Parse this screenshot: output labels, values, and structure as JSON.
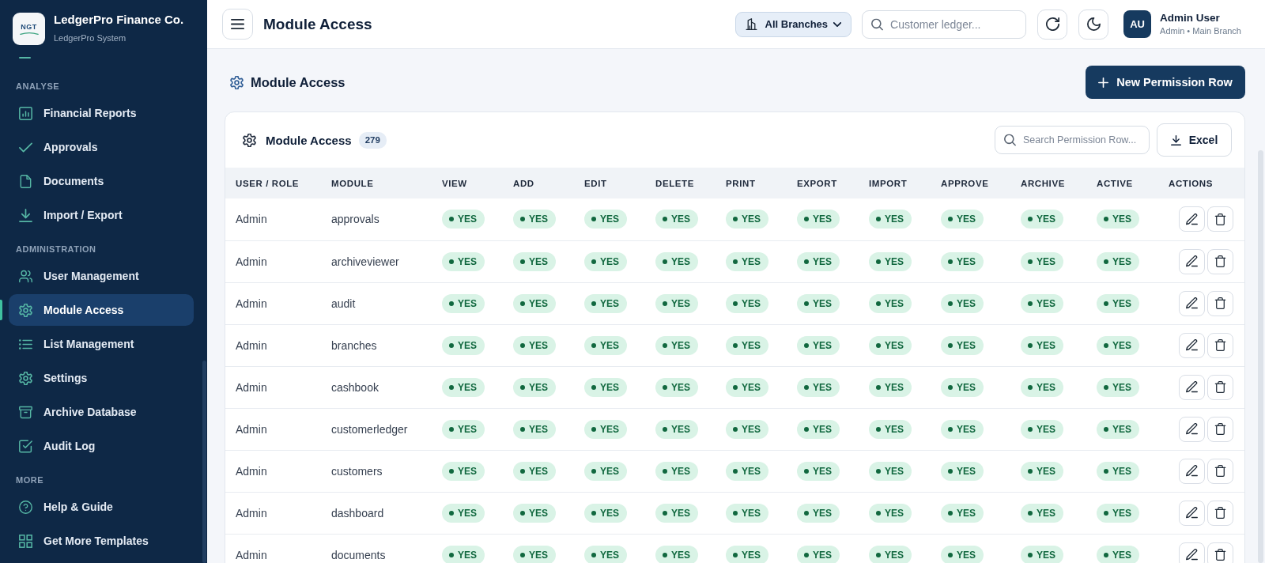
{
  "sidebar": {
    "brand": {
      "logo_text": "NGT",
      "name": "LedgerPro Finance Co.",
      "subtitle": "LedgerPro System"
    },
    "sections": [
      {
        "label": "ANALYSE",
        "items": [
          {
            "label": "Financial Reports",
            "selected": false
          },
          {
            "label": "Approvals",
            "selected": false
          },
          {
            "label": "Documents",
            "selected": false
          },
          {
            "label": "Import / Export",
            "selected": false
          }
        ]
      },
      {
        "label": "ADMINISTRATION",
        "items": [
          {
            "label": "User Management",
            "selected": false
          },
          {
            "label": "Module Access",
            "selected": true
          },
          {
            "label": "List Management",
            "selected": false
          },
          {
            "label": "Settings",
            "selected": false
          },
          {
            "label": "Archive Database",
            "selected": false
          },
          {
            "label": "Audit Log",
            "selected": false
          }
        ]
      },
      {
        "label": "MORE",
        "items": [
          {
            "label": "Help & Guide",
            "selected": false
          },
          {
            "label": "Get More Templates",
            "selected": false
          }
        ]
      }
    ]
  },
  "header": {
    "title": "Module Access",
    "branch_filter": "All Branches",
    "search": {
      "placeholder": "Customer ledger..."
    },
    "user": {
      "initials": "AU",
      "name": "Admin User",
      "role": "Admin • Main Branch"
    }
  },
  "page": {
    "title": "Module Access",
    "new_button": "New Permission Row"
  },
  "table_card": {
    "title": "Module Access",
    "count": "279",
    "search": {
      "placeholder": "Search Permission Row..."
    },
    "export_button": "Excel",
    "columns": [
      "USER / ROLE",
      "MODULE",
      "VIEW",
      "ADD",
      "EDIT",
      "DELETE",
      "PRINT",
      "EXPORT",
      "IMPORT",
      "APPROVE",
      "ARCHIVE",
      "ACTIVE",
      "ACTIONS"
    ],
    "rows": [
      {
        "user": "Admin",
        "module": "approvals",
        "permissions": [
          {
            "label": "YES",
            "granted": true
          },
          {
            "label": "YES",
            "granted": true
          },
          {
            "label": "YES",
            "granted": true
          },
          {
            "label": "YES",
            "granted": true
          },
          {
            "label": "YES",
            "granted": true
          },
          {
            "label": "YES",
            "granted": true
          },
          {
            "label": "YES",
            "granted": true
          },
          {
            "label": "YES",
            "granted": true
          },
          {
            "label": "YES",
            "granted": true
          },
          {
            "label": "YES",
            "granted": true
          }
        ]
      },
      {
        "user": "Admin",
        "module": "archiveviewer",
        "permissions": [
          {
            "label": "YES",
            "granted": true
          },
          {
            "label": "YES",
            "granted": true
          },
          {
            "label": "YES",
            "granted": true
          },
          {
            "label": "YES",
            "granted": true
          },
          {
            "label": "YES",
            "granted": true
          },
          {
            "label": "YES",
            "granted": true
          },
          {
            "label": "YES",
            "granted": true
          },
          {
            "label": "YES",
            "granted": true
          },
          {
            "label": "YES",
            "granted": true
          },
          {
            "label": "YES",
            "granted": true
          }
        ]
      },
      {
        "user": "Admin",
        "module": "audit",
        "permissions": [
          {
            "label": "YES",
            "granted": true
          },
          {
            "label": "YES",
            "granted": true
          },
          {
            "label": "YES",
            "granted": true
          },
          {
            "label": "YES",
            "granted": true
          },
          {
            "label": "YES",
            "granted": true
          },
          {
            "label": "YES",
            "granted": true
          },
          {
            "label": "YES",
            "granted": true
          },
          {
            "label": "YES",
            "granted": true
          },
          {
            "label": "YES",
            "granted": true
          },
          {
            "label": "YES",
            "granted": true
          }
        ]
      },
      {
        "user": "Admin",
        "module": "branches",
        "permissions": [
          {
            "label": "YES",
            "granted": true
          },
          {
            "label": "YES",
            "granted": true
          },
          {
            "label": "YES",
            "granted": true
          },
          {
            "label": "YES",
            "granted": true
          },
          {
            "label": "YES",
            "granted": true
          },
          {
            "label": "YES",
            "granted": true
          },
          {
            "label": "YES",
            "granted": true
          },
          {
            "label": "YES",
            "granted": true
          },
          {
            "label": "YES",
            "granted": true
          },
          {
            "label": "YES",
            "granted": true
          }
        ]
      },
      {
        "user": "Admin",
        "module": "cashbook",
        "permissions": [
          {
            "label": "YES",
            "granted": true
          },
          {
            "label": "YES",
            "granted": true
          },
          {
            "label": "YES",
            "granted": true
          },
          {
            "label": "YES",
            "granted": true
          },
          {
            "label": "YES",
            "granted": true
          },
          {
            "label": "YES",
            "granted": true
          },
          {
            "label": "YES",
            "granted": true
          },
          {
            "label": "YES",
            "granted": true
          },
          {
            "label": "YES",
            "granted": true
          },
          {
            "label": "YES",
            "granted": true
          }
        ]
      },
      {
        "user": "Admin",
        "module": "customerledger",
        "permissions": [
          {
            "label": "YES",
            "granted": true
          },
          {
            "label": "YES",
            "granted": true
          },
          {
            "label": "YES",
            "granted": true
          },
          {
            "label": "YES",
            "granted": true
          },
          {
            "label": "YES",
            "granted": true
          },
          {
            "label": "YES",
            "granted": true
          },
          {
            "label": "YES",
            "granted": true
          },
          {
            "label": "YES",
            "granted": true
          },
          {
            "label": "YES",
            "granted": true
          },
          {
            "label": "YES",
            "granted": true
          }
        ]
      },
      {
        "user": "Admin",
        "module": "customers",
        "permissions": [
          {
            "label": "YES",
            "granted": true
          },
          {
            "label": "YES",
            "granted": true
          },
          {
            "label": "YES",
            "granted": true
          },
          {
            "label": "YES",
            "granted": true
          },
          {
            "label": "YES",
            "granted": true
          },
          {
            "label": "YES",
            "granted": true
          },
          {
            "label": "YES",
            "granted": true
          },
          {
            "label": "YES",
            "granted": true
          },
          {
            "label": "YES",
            "granted": true
          },
          {
            "label": "YES",
            "granted": true
          }
        ]
      },
      {
        "user": "Admin",
        "module": "dashboard",
        "permissions": [
          {
            "label": "YES",
            "granted": true
          },
          {
            "label": "YES",
            "granted": true
          },
          {
            "label": "YES",
            "granted": true
          },
          {
            "label": "YES",
            "granted": true
          },
          {
            "label": "YES",
            "granted": true
          },
          {
            "label": "YES",
            "granted": true
          },
          {
            "label": "YES",
            "granted": true
          },
          {
            "label": "YES",
            "granted": true
          },
          {
            "label": "YES",
            "granted": true
          },
          {
            "label": "YES",
            "granted": true
          }
        ]
      },
      {
        "user": "Admin",
        "module": "documents",
        "permissions": [
          {
            "label": "YES",
            "granted": true
          },
          {
            "label": "YES",
            "granted": true
          },
          {
            "label": "YES",
            "granted": true
          },
          {
            "label": "YES",
            "granted": true
          },
          {
            "label": "YES",
            "granted": true
          },
          {
            "label": "YES",
            "granted": true
          },
          {
            "label": "YES",
            "granted": true
          },
          {
            "label": "YES",
            "granted": true
          },
          {
            "label": "YES",
            "granted": true
          },
          {
            "label": "YES",
            "granted": true
          }
        ]
      }
    ]
  }
}
